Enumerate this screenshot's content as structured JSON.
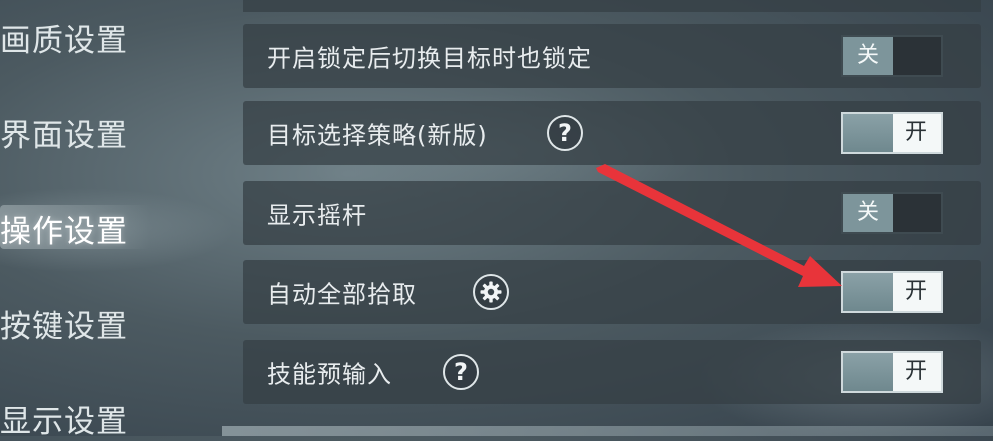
{
  "sidebar": {
    "items": [
      {
        "label": "画质设置"
      },
      {
        "label": "界面设置"
      },
      {
        "label": "操作设置"
      },
      {
        "label": "按键设置"
      },
      {
        "label": "显示设置"
      }
    ]
  },
  "settings": {
    "rows": [
      {
        "label": "开启锁定后切换目标时也锁定",
        "toggle": "关"
      },
      {
        "label": "目标选择策略(新版)",
        "help": "?",
        "toggle": "开"
      },
      {
        "label": "显示摇杆",
        "toggle": "关"
      },
      {
        "label": "自动全部拾取",
        "toggle": "开"
      },
      {
        "label": "技能预输入",
        "help": "?",
        "toggle": "开"
      }
    ]
  },
  "annotation": {
    "arrow_color": "#e8343a",
    "target": "自动全部拾取 toggle"
  }
}
